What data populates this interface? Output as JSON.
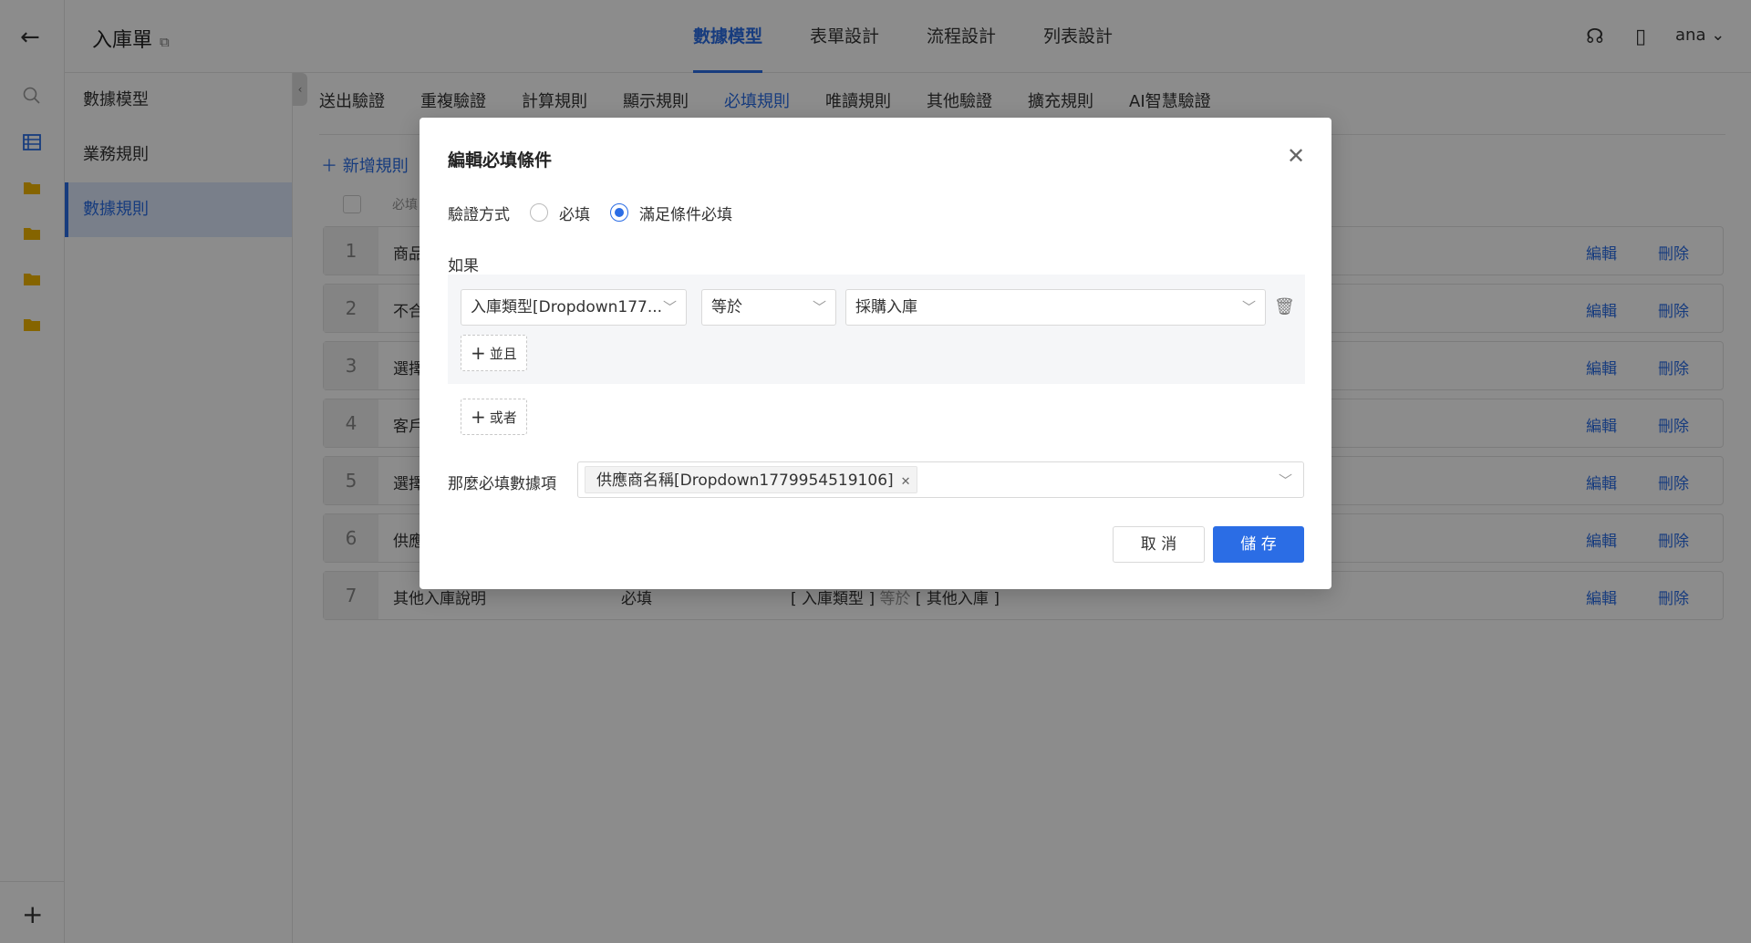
{
  "rail": {
    "back_icon": "arrow-left-icon",
    "icons": [
      "search-icon",
      "table-icon",
      "folder-icon",
      "folder-icon",
      "folder-icon",
      "folder-icon"
    ],
    "add_icon": "plus-icon",
    "colors": {
      "table": "#2b6de5",
      "folder": "#f2b600"
    }
  },
  "header": {
    "title": "入庫單",
    "tabs": [
      "數據模型",
      "表單設計",
      "流程設計",
      "列表設計"
    ],
    "active_tab": "數據模型",
    "user": "ana"
  },
  "subnav": {
    "items": [
      "數據模型",
      "業務規則",
      "數據規則"
    ],
    "active": "數據規則"
  },
  "rule_tabs": {
    "items": [
      "送出驗證",
      "重複驗證",
      "計算規則",
      "顯示規則",
      "必填規則",
      "唯讀規則",
      "其他驗證",
      "擴充規則",
      "AI智慧驗證"
    ],
    "active": "必填規則"
  },
  "rules_list": {
    "add_label": "新增規則",
    "header_label": "必填",
    "rows": [
      {
        "index": "1",
        "name": "商品",
        "type": "",
        "field": "",
        "op": "",
        "value": ""
      },
      {
        "index": "2",
        "name": "不合",
        "type": "",
        "field": "",
        "op": "",
        "value": ""
      },
      {
        "index": "3",
        "name": "選擇",
        "type": "",
        "field": "",
        "op": "",
        "value": ""
      },
      {
        "index": "4",
        "name": "客戶",
        "type": "",
        "field": "",
        "op": "",
        "value": ""
      },
      {
        "index": "5",
        "name": "選擇",
        "type": "",
        "field": "",
        "op": "",
        "value": ""
      },
      {
        "index": "6",
        "name": "供應",
        "type": "",
        "field": "",
        "op": "",
        "value": ""
      },
      {
        "index": "7",
        "name": "其他入庫說明",
        "type": "必填",
        "field": "[ 入庫類型 ]",
        "op": "等於",
        "value": "[ 其他入庫 ]"
      }
    ],
    "edit_label": "編輯",
    "delete_label": "刪除"
  },
  "modal": {
    "title": "編輯必填條件",
    "verify_label": "驗證方式",
    "radio_required": "必填",
    "radio_conditional": "滿足條件必填",
    "selected_radio": "滿足條件必填",
    "if_label": "如果",
    "field_select": "入庫類型[Dropdown177...",
    "operator_select": "等於",
    "value_select": "採購入庫",
    "and_button": "並且",
    "or_button": "或者",
    "then_label": "那麼必填數據項",
    "required_field_tag": "供應商名稱[Dropdown1779954519106]",
    "cancel_button": "取 消",
    "save_button": "儲 存",
    "accent_color": "#2b6de5"
  }
}
